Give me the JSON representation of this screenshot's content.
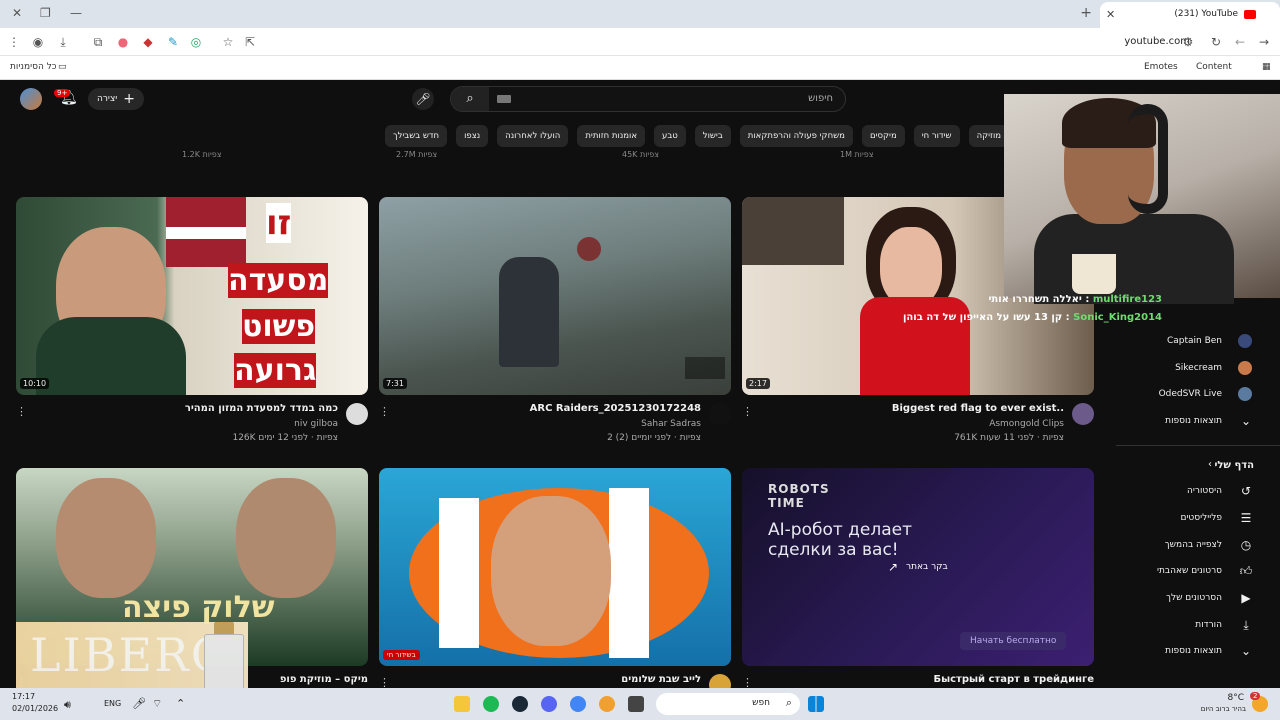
{
  "browser": {
    "tab_title": "(231) YouTube",
    "url": "youtube.com",
    "bookmarks": {
      "all": "כל הסימניות",
      "emotes": "Emotes",
      "content": "Content"
    }
  },
  "youtube": {
    "create_label": "יצירה",
    "notif_count": "9+",
    "search_placeholder": "חיפוש",
    "chips": [
      "מוזיקה",
      "שידור חי",
      "מיקסים",
      "משחקי פעולה והרפתקאות",
      "בישול",
      "טבע",
      "אומנות חזותית",
      "הועלו לאחרונה",
      "נצפו",
      "חדש בשבילך"
    ],
    "above_row": [
      "1.2K צפיות",
      "2.7M צפיות",
      "45K צפיות",
      "1M צפיות"
    ],
    "videos": [
      {
        "title": "כמה במדד למסעדת המזון המהיר",
        "channel": "niv gilboa",
        "meta": "126K צפיות · לפני 12 ימים",
        "duration": "10:10"
      },
      {
        "title": "ARC Raiders_20251230172248",
        "channel": "Sahar Sadras",
        "meta": "2 צפיות · לפני יומיים (2)",
        "duration": "7:31"
      },
      {
        "title": "Biggest red flag to ever exist..",
        "channel": "Asmongold Clips",
        "meta": "761K צפיות · לפני 11 שעות",
        "duration": "2:17"
      },
      {
        "title": "מיקס – מוזיקת פופ",
        "channel": "",
        "meta": "",
        "duration": ""
      },
      {
        "title": "לייב שבת שלומים",
        "channel": "",
        "meta": "",
        "duration": "",
        "live": "בשידור חי"
      },
      {
        "title": "Быстрый старт в трейдинге",
        "channel": "",
        "meta": "",
        "duration": ""
      }
    ],
    "thumb_text": {
      "v1": [
        "זו",
        "מסעדה",
        "פשוט",
        "גרועה"
      ],
      "v4": "שלוק פיצה",
      "v6_brand": "ROBOTS TIME",
      "v6_head": "AI-робот делает сделки за вас!",
      "v6_visit": "בקר באתר",
      "v6_cta": "Начать бесплатно"
    },
    "chat": [
      {
        "user": "multifire123",
        "text": "יאללה תשחררו אותי :"
      },
      {
        "user": "Sonic_King2014",
        "text": "קן 13 עשו על האייפון של דה בוהן :"
      }
    ],
    "subscriptions": [
      {
        "name": "Captain Ben"
      },
      {
        "name": "Sikecream"
      },
      {
        "name": "OdedSVR Live"
      }
    ],
    "show_more": "תוצאות נוספות",
    "you_header": "הדף שלי",
    "you_items": [
      "היסטוריה",
      "פלייליסטים",
      "לצפייה בהמשך",
      "סרטונים שאהבתי",
      "הסרטונים שלך",
      "הורדות",
      "תוצאות נוספות"
    ],
    "ad_text": "LIBERO"
  },
  "taskbar": {
    "time": "17:17",
    "date": "02/01/2026",
    "lang": "ENG",
    "search": "חפש",
    "weather_temp": "8°C",
    "weather_desc": "בהיר ברוב היום",
    "weather_badge": "2"
  }
}
